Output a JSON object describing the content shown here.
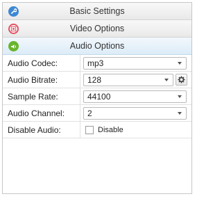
{
  "sections": {
    "basic": {
      "title": "Basic Settings",
      "icon": "wrench-icon"
    },
    "video": {
      "title": "Video Options",
      "icon": "film-icon"
    },
    "audio": {
      "title": "Audio Options",
      "icon": "speaker-icon"
    }
  },
  "form": {
    "codec": {
      "label": "Audio Codec:",
      "value": "mp3"
    },
    "bitrate": {
      "label": "Audio Bitrate:",
      "value": "128"
    },
    "samplerate": {
      "label": "Sample Rate:",
      "value": "44100"
    },
    "channel": {
      "label": "Audio Channel:",
      "value": "2"
    },
    "disable": {
      "label": "Disable Audio:",
      "checkbox_label": "Disable",
      "checked": false
    }
  },
  "colors": {
    "active_header": "#dcecf7",
    "wrench": "#3d88d4",
    "film": "#e05263",
    "speaker": "#67b52c"
  }
}
